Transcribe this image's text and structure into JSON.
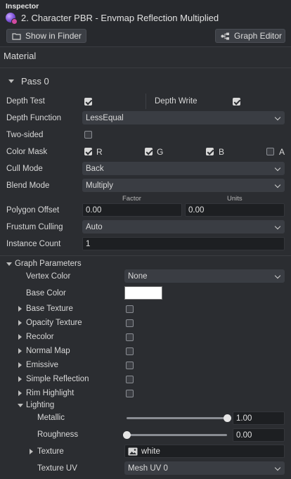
{
  "header": {
    "inspector_label": "Inspector",
    "asset_title": "2. Character PBR - Envmap Reflection Multiplied",
    "show_in_finder": "Show in Finder",
    "graph_editor": "Graph Editor"
  },
  "material": {
    "section_label": "Material",
    "pass_label": "Pass 0",
    "depth_test_label": "Depth Test",
    "depth_test_checked": true,
    "depth_write_label": "Depth Write",
    "depth_write_checked": true,
    "depth_function_label": "Depth Function",
    "depth_function_value": "LessEqual",
    "two_sided_label": "Two-sided",
    "two_sided_checked": false,
    "color_mask_label": "Color Mask",
    "color_mask": [
      {
        "label": "R",
        "checked": true
      },
      {
        "label": "G",
        "checked": true
      },
      {
        "label": "B",
        "checked": true
      },
      {
        "label": "A",
        "checked": false
      }
    ],
    "cull_mode_label": "Cull Mode",
    "cull_mode_value": "Back",
    "blend_mode_label": "Blend Mode",
    "blend_mode_value": "Multiply",
    "polygon_offset_label": "Polygon Offset",
    "factor_header": "Factor",
    "units_header": "Units",
    "factor_value": "0.00",
    "units_value": "0.00",
    "frustum_culling_label": "Frustum Culling",
    "frustum_culling_value": "Auto",
    "instance_count_label": "Instance Count",
    "instance_count_value": "1"
  },
  "graph_parameters": {
    "section_label": "Graph Parameters",
    "vertex_color_label": "Vertex Color",
    "vertex_color_value": "None",
    "base_color_label": "Base Color",
    "base_color_hex": "#ffffff",
    "toggles": [
      {
        "label": "Base Texture",
        "checked": false
      },
      {
        "label": "Opacity Texture",
        "checked": false
      },
      {
        "label": "Recolor",
        "checked": false
      },
      {
        "label": "Normal Map",
        "checked": false
      },
      {
        "label": "Emissive",
        "checked": false
      },
      {
        "label": "Simple Reflection",
        "checked": false
      },
      {
        "label": "Rim Highlight",
        "checked": false
      }
    ],
    "lighting_label": "Lighting",
    "metallic_label": "Metallic",
    "metallic_value": "1.00",
    "metallic_fraction": 1.0,
    "roughness_label": "Roughness",
    "roughness_value": "0.00",
    "roughness_fraction": 0.0,
    "texture_label": "Texture",
    "texture_value": "white",
    "texture_uv_label": "Texture UV",
    "texture_uv_value": "Mesh UV 0"
  },
  "colors": {
    "background": "#2b2d31",
    "field_dark": "#1d1f22",
    "dropdown": "#3a3d43"
  }
}
